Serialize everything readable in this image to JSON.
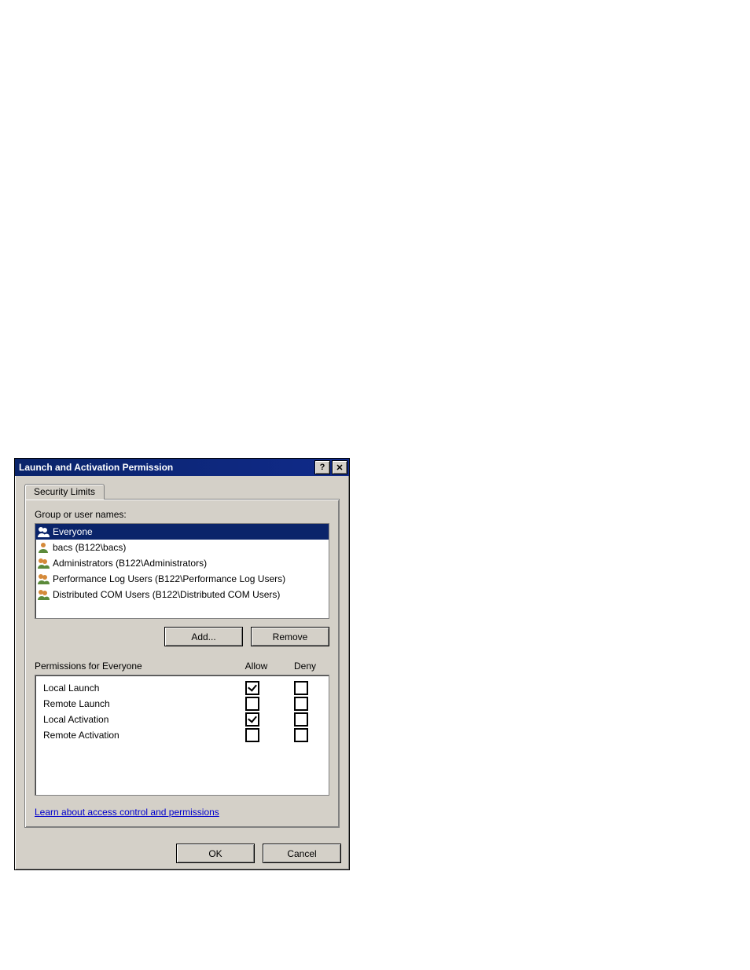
{
  "dialog": {
    "title": "Launch and Activation Permission",
    "tab_label": "Security Limits",
    "group_label": "Group or user names:",
    "users": [
      {
        "name": "Everyone",
        "selected": true,
        "icon": "group"
      },
      {
        "name": "bacs (B122\\bacs)",
        "selected": false,
        "icon": "user"
      },
      {
        "name": "Administrators (B122\\Administrators)",
        "selected": false,
        "icon": "group"
      },
      {
        "name": "Performance Log Users (B122\\Performance Log Users)",
        "selected": false,
        "icon": "group"
      },
      {
        "name": "Distributed COM Users (B122\\Distributed COM Users)",
        "selected": false,
        "icon": "group"
      }
    ],
    "add_label": "Add...",
    "remove_label": "Remove",
    "perm_header": "Permissions for Everyone",
    "col_allow": "Allow",
    "col_deny": "Deny",
    "permissions": [
      {
        "name": "Local Launch",
        "allow": true,
        "deny": false
      },
      {
        "name": "Remote Launch",
        "allow": false,
        "deny": false
      },
      {
        "name": "Local Activation",
        "allow": true,
        "deny": false
      },
      {
        "name": "Remote Activation",
        "allow": false,
        "deny": false
      }
    ],
    "link_text": "Learn about access control and permissions",
    "ok_label": "OK",
    "cancel_label": "Cancel"
  }
}
